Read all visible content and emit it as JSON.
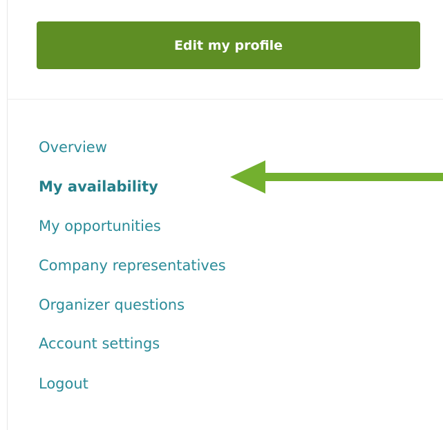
{
  "profile": {
    "edit_button_label": "Edit my profile",
    "button_color": "#5e8e24"
  },
  "nav": {
    "link_color": "#2b8c99",
    "active_index": 1,
    "items": [
      {
        "label": "Overview"
      },
      {
        "label": "My availability"
      },
      {
        "label": "My opportunities"
      },
      {
        "label": "Company representatives"
      },
      {
        "label": "Organizer questions"
      },
      {
        "label": "Account settings"
      },
      {
        "label": "Logout"
      }
    ]
  },
  "annotation": {
    "arrow_color": "#73b02f",
    "points_to": "My availability",
    "icon": "left-arrow-icon"
  }
}
